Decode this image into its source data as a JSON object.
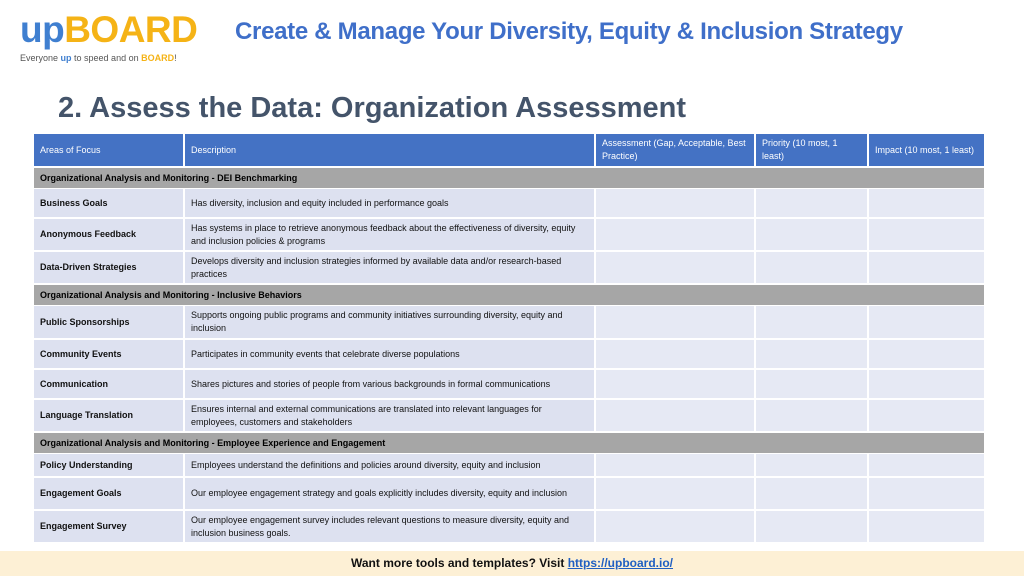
{
  "logo": {
    "up": "up",
    "board": "BOARD",
    "tagline_pre": "Everyone ",
    "tagline_up": "up",
    "tagline_mid": " to speed and on ",
    "tagline_board": "BOARD",
    "tagline_end": "!"
  },
  "header": {
    "title": "Create & Manage Your Diversity, Equity & Inclusion Strategy"
  },
  "page_title": "2. Assess the Data: Organization Assessment",
  "table": {
    "columns": [
      "Areas of Focus",
      "Description",
      "Assessment (Gap, Acceptable, Best Practice)",
      "Priority (10 most, 1 least)",
      "Impact (10 most, 1 least)"
    ],
    "sections": [
      {
        "title": "Organizational Analysis and Monitoring - DEI Benchmarking",
        "rows": [
          {
            "area": "Business Goals",
            "desc": "Has diversity, inclusion and equity included in performance goals",
            "h": 30
          },
          {
            "area": "Anonymous Feedback",
            "desc": "Has systems in place to retrieve  anonymous feedback about the effectiveness of diversity, equity and inclusion policies & programs",
            "h": 33
          },
          {
            "area": "Data-Driven Strategies",
            "desc": "Develops diversity and inclusion strategies informed by available data and/or research-based practices",
            "h": 33
          }
        ]
      },
      {
        "title": "Organizational Analysis and Monitoring - Inclusive Behaviors",
        "rows": [
          {
            "area": "Public Sponsorships",
            "desc": "Supports ongoing public programs and community initiatives surrounding diversity, equity and inclusion",
            "h": 34
          },
          {
            "area": "Community Events",
            "desc": "Participates in community events that celebrate diverse populations",
            "h": 30
          },
          {
            "area": "Communication",
            "desc": "Shares pictures and stories of people from various backgrounds in formal communications",
            "h": 30
          },
          {
            "area": "Language Translation",
            "desc": "Ensures internal and external communications are translated into relevant languages for employees, customers and stakeholders",
            "h": 33
          }
        ]
      },
      {
        "title": "Organizational Analysis and Monitoring - Employee Experience and Engagement",
        "rows": [
          {
            "area": "Policy Understanding",
            "desc": "Employees understand the definitions and policies around diversity, equity and inclusion",
            "h": 24
          },
          {
            "area": "Engagement Goals",
            "desc": "Our employee engagement strategy and goals explicitly includes diversity, equity and inclusion",
            "h": 33
          },
          {
            "area": "Engagement Survey",
            "desc": "Our employee engagement survey includes relevant questions to measure diversity, equity and inclusion business goals.",
            "h": 33
          }
        ]
      }
    ]
  },
  "footer": {
    "text": "Want more tools and templates? Visit ",
    "link": "https://upboard.io/"
  }
}
